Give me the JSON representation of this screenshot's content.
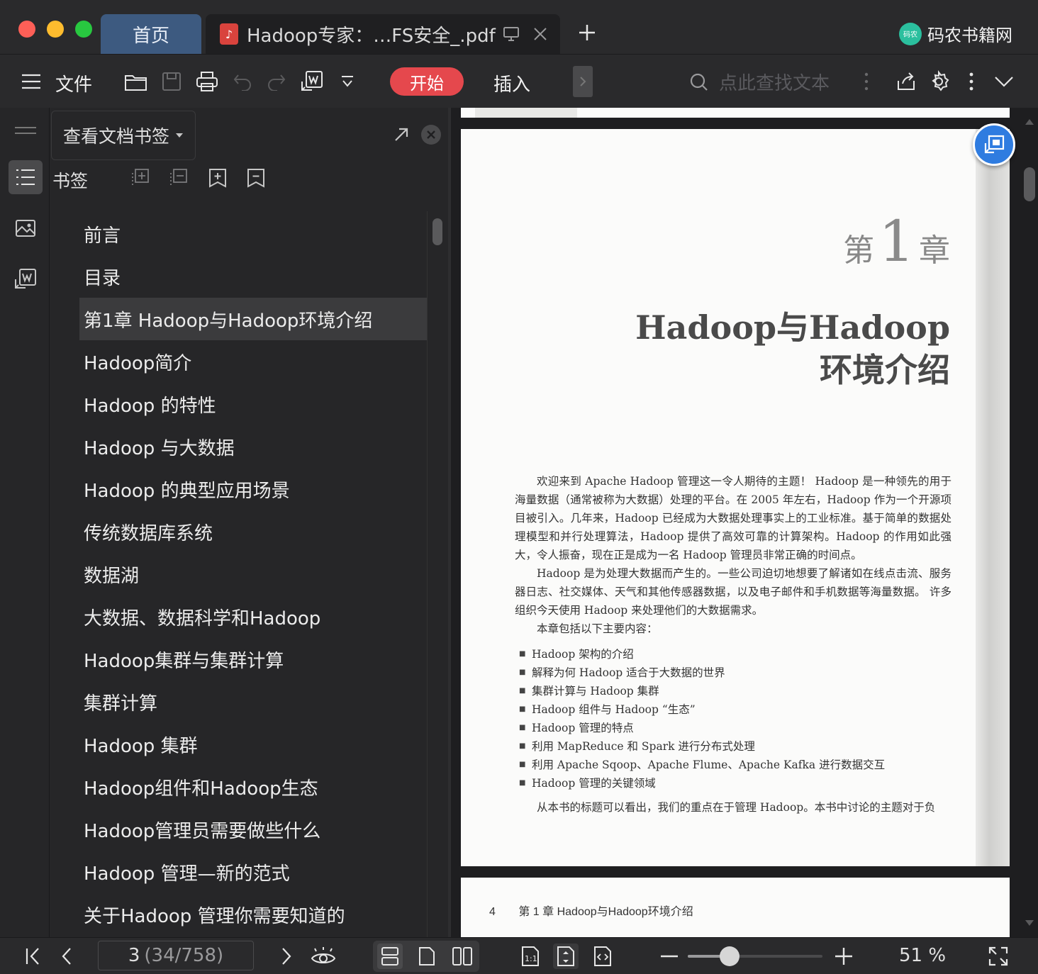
{
  "titlebar": {
    "tabs": [
      {
        "label": "首页"
      },
      {
        "label": "Hadoop专家：…FS安全_.pdf",
        "badge": "♪"
      }
    ],
    "brand": {
      "label": "码农书籍网",
      "logo_text": "码农"
    }
  },
  "toolbar": {
    "file_label": "文件",
    "start_label": "开始",
    "insert_label": "插入",
    "search_placeholder": "点此查找文本"
  },
  "bookmark_panel": {
    "dropdown_label": "查看文档书签",
    "section_label": "书签",
    "items": [
      "前言",
      "目录",
      "第1章 Hadoop与Hadoop环境介绍",
      "Hadoop简介",
      "Hadoop 的特性",
      "Hadoop 与大数据",
      "Hadoop 的典型应用场景",
      "传统数据库系统",
      "数据湖",
      "大数据、数据科学和Hadoop",
      "Hadoop集群与集群计算",
      "集群计算",
      "Hadoop 集群",
      "Hadoop组件和Hadoop生态",
      "Hadoop管理员需要做些什么",
      "Hadoop 管理—新的范式",
      "关于Hadoop 管理你需要知道的"
    ],
    "active_index": 2
  },
  "document": {
    "chapter_prefix": "第",
    "chapter_number": "1",
    "chapter_suffix": "章",
    "title_line1": "Hadoop与Hadoop",
    "title_line2": "环境介绍",
    "paragraphs": [
      "欢迎来到 Apache Hadoop 管理这一令人期待的主题！ Hadoop 是一种领先的用于海量数据（通常被称为大数据）处理的平台。在 2005 年左右，Hadoop 作为一个开源项目被引入。几年来，Hadoop 已经成为大数据处理事实上的工业标准。基于简单的数据处理模型和并行处理算法，Hadoop 提供了高效可靠的计算架构。Hadoop 的作用如此强大，令人振奋，现在正是成为一名 Hadoop 管理员非常正确的时间点。",
      "Hadoop 是为处理大数据而产生的。一些公司迫切地想要了解诸如在线点击流、服务器日志、社交媒体、天气和其他传感器数据，以及电子邮件和手机数据等海量数据。 许多组织今天使用 Hadoop 来处理他们的大数据需求。",
      "本章包括以下主要内容："
    ],
    "bullets": [
      "Hadoop 架构的介绍",
      "解释为何 Hadoop 适合于大数据的世界",
      "集群计算与 Hadoop 集群",
      "Hadoop 组件与 Hadoop “生态”",
      "Hadoop 管理的特点",
      "利用 MapReduce 和 Spark 进行分布式处理",
      "利用 Apache Sqoop、Apache Flume、Apache Kafka 进行数据交互",
      "Hadoop 管理的关键领域"
    ],
    "closing_line": "从本书的标题可以看出，我们的重点在于管理 Hadoop。本书中讨论的主题对于负",
    "next_page_number": "4",
    "next_page_header": "第 1 章    Hadoop与Hadoop环境介绍"
  },
  "statusbar": {
    "page_current": "3",
    "page_detail": "(34/758)",
    "zoom_label": "51 %",
    "zoom_fraction": 0.31
  },
  "colors": {
    "accent_red": "#e5484d",
    "home_tab": "#3d5a80",
    "float_button": "#2f7ce0"
  }
}
